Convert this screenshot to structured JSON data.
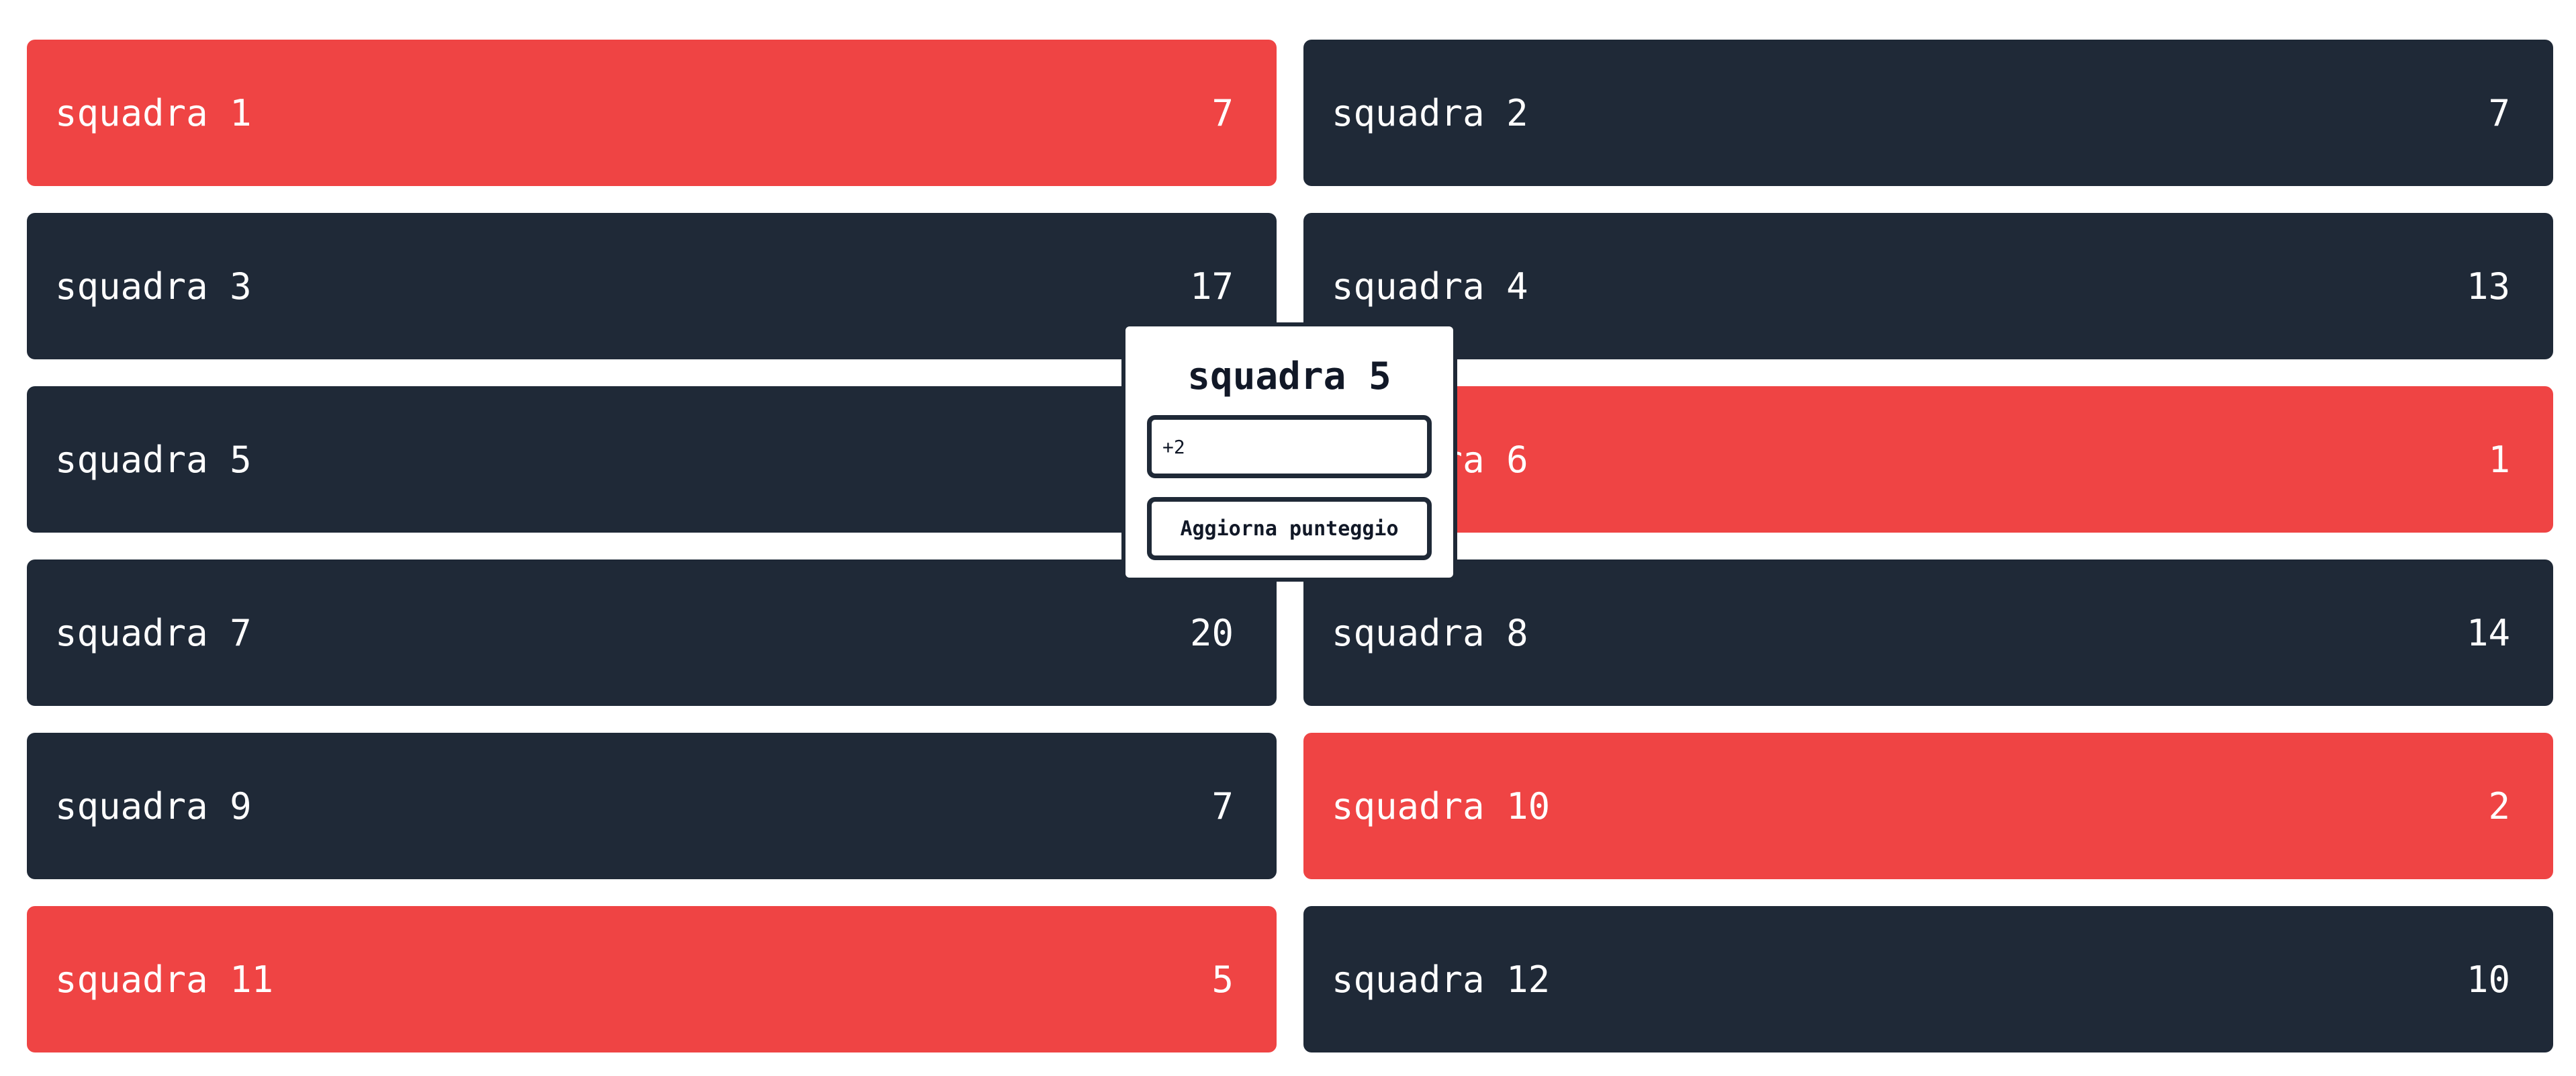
{
  "colors": {
    "team_default": "#1f2937",
    "team_highlight": "#ef4444",
    "text_light": "#ffffff",
    "popup_border": "#1f2937"
  },
  "teams": [
    {
      "name": "squadra 1",
      "score": "7",
      "highlight": true
    },
    {
      "name": "squadra 2",
      "score": "7",
      "highlight": false
    },
    {
      "name": "squadra 3",
      "score": "17",
      "highlight": false
    },
    {
      "name": "squadra 4",
      "score": "13",
      "highlight": false
    },
    {
      "name": "squadra 5",
      "score": "",
      "highlight": false
    },
    {
      "name": "squadra 6",
      "score": "1",
      "highlight": true
    },
    {
      "name": "squadra 7",
      "score": "20",
      "highlight": false
    },
    {
      "name": "squadra 8",
      "score": "14",
      "highlight": false
    },
    {
      "name": "squadra 9",
      "score": "7",
      "highlight": false
    },
    {
      "name": "squadra 10",
      "score": "2",
      "highlight": true
    },
    {
      "name": "squadra 11",
      "score": "5",
      "highlight": true
    },
    {
      "name": "squadra 12",
      "score": "10",
      "highlight": false
    }
  ],
  "popup": {
    "title": "squadra 5",
    "input_value": "+2",
    "button_label": "Aggiorna punteggio"
  }
}
